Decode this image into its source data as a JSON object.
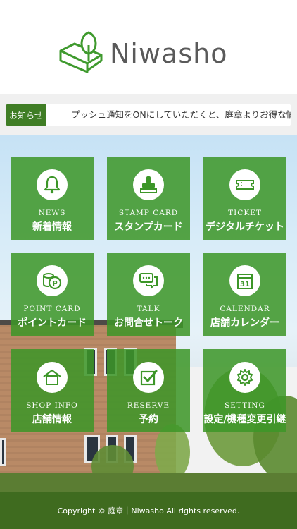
{
  "header": {
    "brand": "Niwasho"
  },
  "ticker": {
    "badge": "お知らせ",
    "message": "プッシュ通知をONにしていただくと、庭章よりお得な情報をお知らせ"
  },
  "tiles": [
    {
      "en": "NEWS",
      "jp": "新着情報",
      "icon": "bell-icon"
    },
    {
      "en": "STAMP CARD",
      "jp": "スタンプカード",
      "icon": "stamp-icon"
    },
    {
      "en": "TICKET",
      "jp": "デジタルチケット",
      "icon": "ticket-icon"
    },
    {
      "en": "POINT CARD",
      "jp": "ポイントカード",
      "icon": "coins-icon"
    },
    {
      "en": "TALK",
      "jp": "お問合せトーク",
      "icon": "chat-icon"
    },
    {
      "en": "CALENDAR",
      "jp": "店舗カレンダー",
      "icon": "calendar-icon",
      "day": "31"
    },
    {
      "en": "SHOP INFO",
      "jp": "店舗情報",
      "icon": "shop-icon"
    },
    {
      "en": "RESERVE",
      "jp": "予約",
      "icon": "checkbox-icon"
    },
    {
      "en": "SETTING",
      "jp": "設定/機種変更引継",
      "icon": "gear-icon"
    }
  ],
  "footer": {
    "copyright": "Copyright © 庭章｜Niwasho All rights reserved."
  },
  "colors": {
    "brand_green": "#3f7d25",
    "tile_green": "#3c9628",
    "footer_green": "#3f6b1f"
  }
}
